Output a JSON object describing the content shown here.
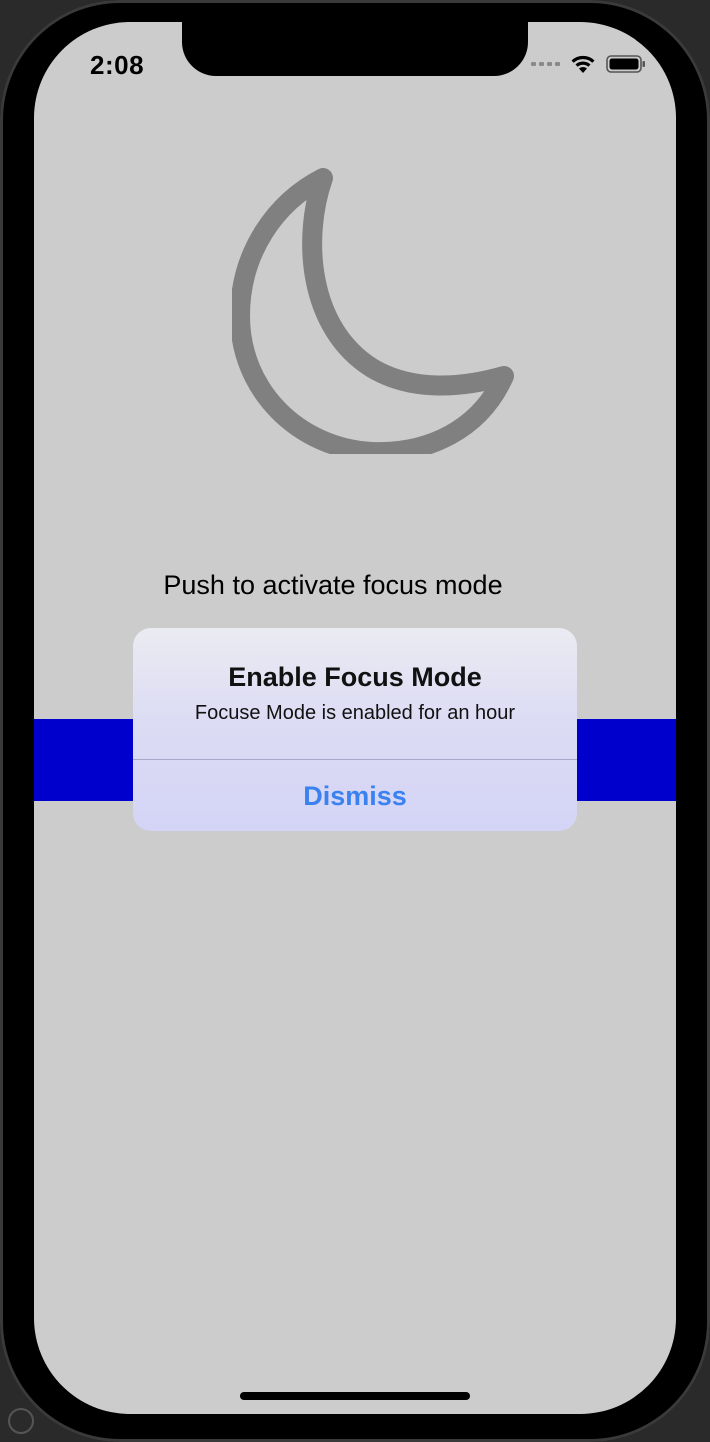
{
  "status_bar": {
    "time": "2:08",
    "icons": [
      "cellular-signal-icon",
      "wifi-icon",
      "battery-icon"
    ]
  },
  "main": {
    "icon": "moon-icon",
    "prompt_text": "Push to activate focus mode",
    "accent_color": "#0000cc"
  },
  "alert": {
    "title": "Enable Focus Mode",
    "message": "Focuse Mode is enabled for an hour",
    "dismiss_label": "Dismiss",
    "button_color": "#3a82f0"
  },
  "colors": {
    "background": "#cccccc",
    "moon_stroke": "#808080"
  }
}
